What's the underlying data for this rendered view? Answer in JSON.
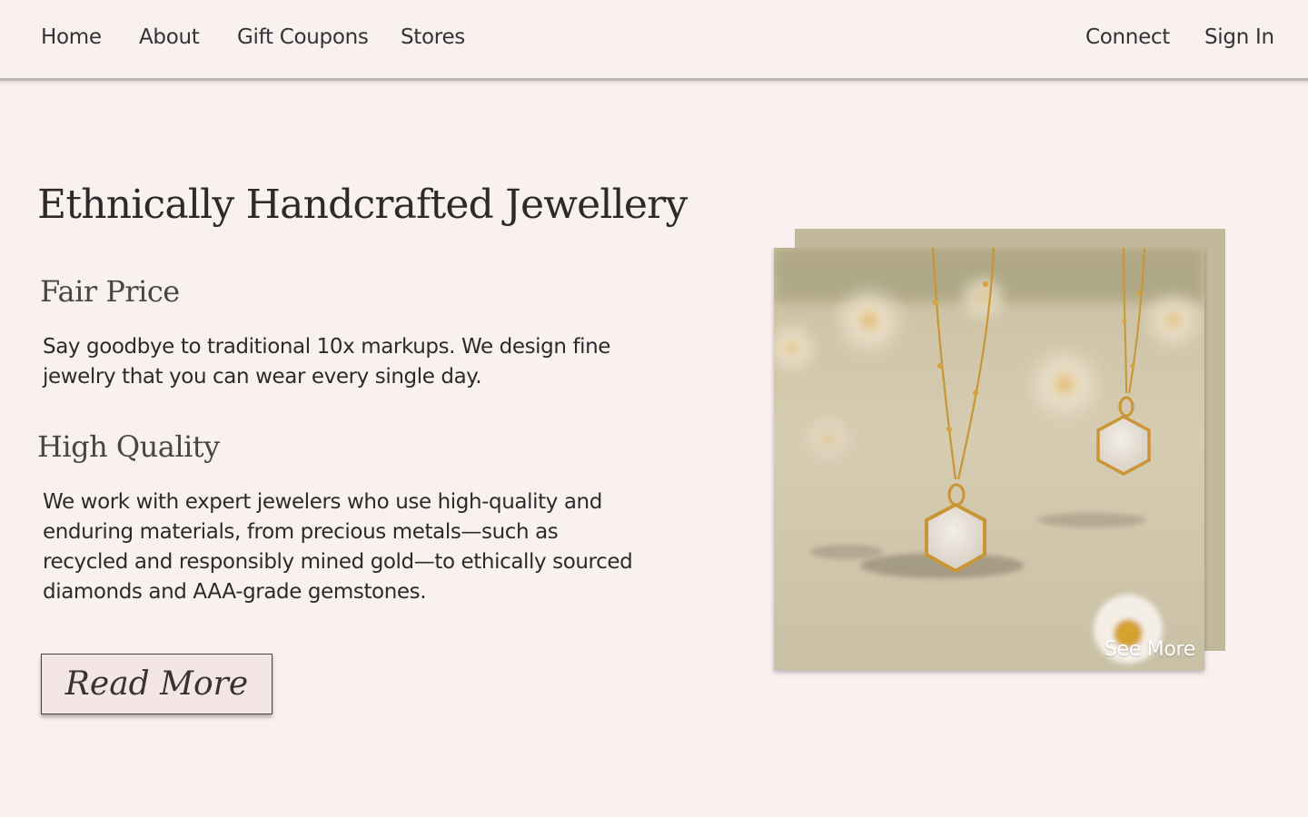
{
  "nav": {
    "left_items": [
      {
        "label": "Home"
      },
      {
        "label": "About"
      },
      {
        "label": "Gift Coupons"
      },
      {
        "label": "Stores"
      }
    ],
    "right_items": [
      {
        "label": "Connect"
      },
      {
        "label": "Sign In"
      }
    ]
  },
  "hero": {
    "title": "Ethnically Handcrafted Jewellery",
    "features": [
      {
        "heading": "Fair Price",
        "text": "Say goodbye to traditional 10x markups. We design fine jewelry that you can wear every single day."
      },
      {
        "heading": "High Quality",
        "text": "We work with expert jewelers who use high-quality and enduring materials, from precious metals—such as recycled and responsibly mined gold—to ethically sourced diamonds and AAA-grade gemstones."
      }
    ],
    "read_more_label": "Read More"
  },
  "gallery": {
    "image_subject": "two gold chain necklaces with hexagonal moonstone pendants among daisies",
    "see_more_label": "See More"
  },
  "colors": {
    "background": "#f9f0f0",
    "text": "#2f2a2a",
    "button_bg": "#f5e6e6",
    "image_backdrop": "#c2b89a"
  }
}
